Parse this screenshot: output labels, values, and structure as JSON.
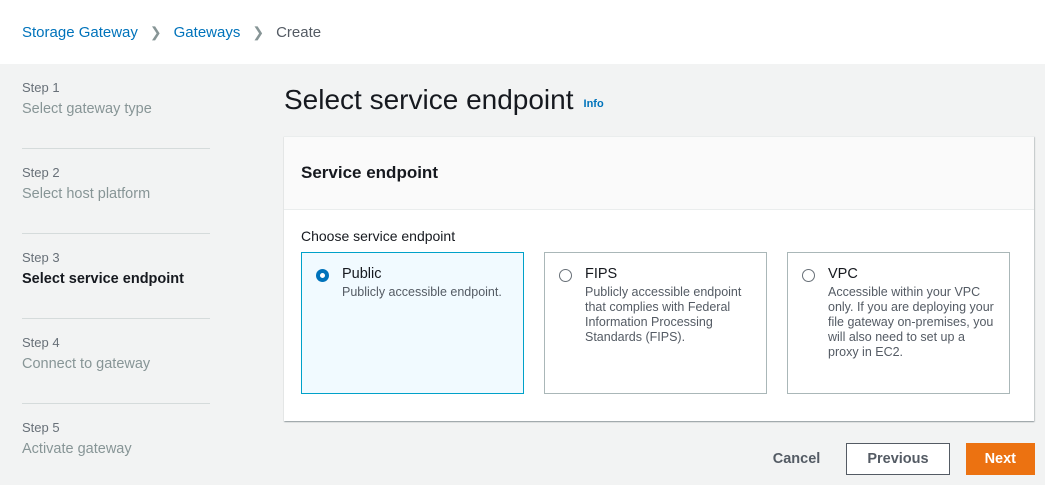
{
  "breadcrumb": {
    "items": [
      "Storage Gateway",
      "Gateways"
    ],
    "current": "Create"
  },
  "steps": [
    {
      "number": "Step 1",
      "title": "Select gateway type"
    },
    {
      "number": "Step 2",
      "title": "Select host platform"
    },
    {
      "number": "Step 3",
      "title": "Select service endpoint"
    },
    {
      "number": "Step 4",
      "title": "Connect to gateway"
    },
    {
      "number": "Step 5",
      "title": "Activate gateway"
    }
  ],
  "active_step": 3,
  "page": {
    "title": "Select service endpoint",
    "info_label": "Info"
  },
  "panel": {
    "title": "Service endpoint",
    "field_label": "Choose service endpoint",
    "options": [
      {
        "label": "Public",
        "description": "Publicly accessible endpoint.",
        "selected": true
      },
      {
        "label": "FIPS",
        "description": "Publicly accessible endpoint that complies with Federal Information Processing Standards (FIPS).",
        "selected": false
      },
      {
        "label": "VPC",
        "description": "Accessible within your VPC only. If you are deploying your file gateway on-premises, you will also need to set up a proxy in EC2.",
        "selected": false
      }
    ]
  },
  "actions": {
    "cancel_label": "Cancel",
    "previous_label": "Previous",
    "next_label": "Next"
  },
  "colors": {
    "link": "#0073bb",
    "primary_button": "#ec7211",
    "selected_border": "#00a1c9"
  }
}
